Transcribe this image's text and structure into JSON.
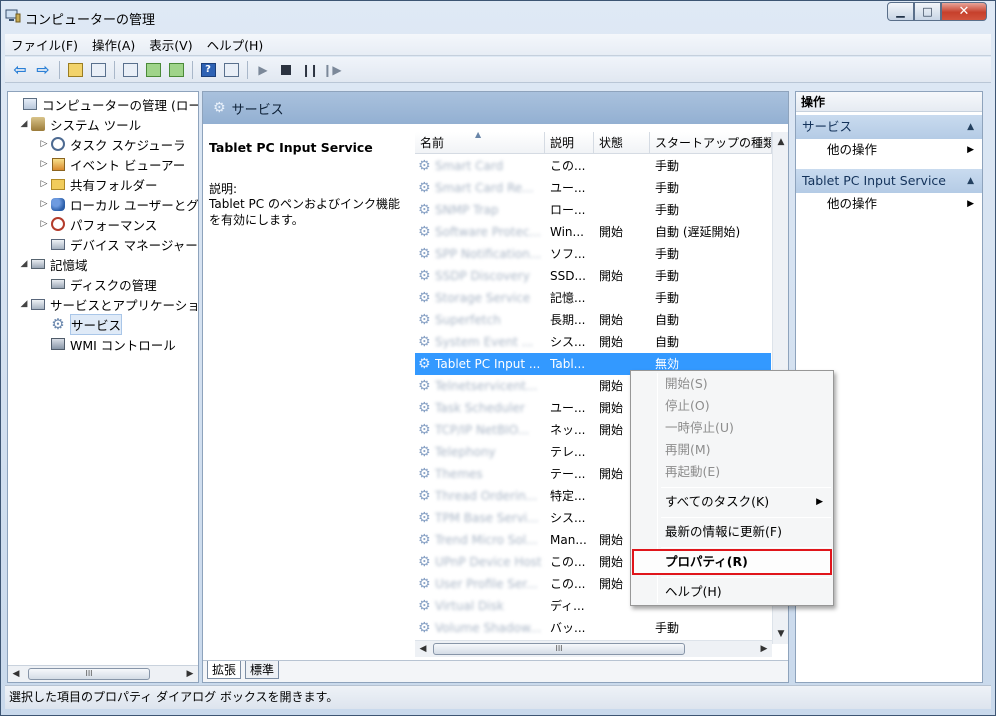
{
  "window": {
    "title": "コンピューターの管理",
    "controls": {
      "minimize": "▁",
      "maximize": "□",
      "close": "✕"
    }
  },
  "menu": [
    "ファイル(F)",
    "操作(A)",
    "表示(V)",
    "ヘルプ(H)"
  ],
  "tree": {
    "items": [
      {
        "label": "コンピューターの管理 (ローカル)",
        "twisty": "",
        "icon": "computer-icon"
      },
      {
        "label": "システム ツール",
        "twisty": "◢",
        "icon": "tools-icon"
      },
      {
        "label": "タスク スケジューラ",
        "twisty": "▷",
        "icon": "clock-icon"
      },
      {
        "label": "イベント ビューアー",
        "twisty": "▷",
        "icon": "event-viewer-icon"
      },
      {
        "label": "共有フォルダー",
        "twisty": "▷",
        "icon": "shared-folder-icon"
      },
      {
        "label": "ローカル ユーザーとグループ",
        "twisty": "▷",
        "icon": "users-icon"
      },
      {
        "label": "パフォーマンス",
        "twisty": "▷",
        "icon": "performance-icon"
      },
      {
        "label": "デバイス マネージャー",
        "twisty": "",
        "icon": "device-manager-icon"
      },
      {
        "label": "記憶域",
        "twisty": "◢",
        "icon": "storage-icon"
      },
      {
        "label": "ディスクの管理",
        "twisty": "",
        "icon": "disk-icon"
      },
      {
        "label": "サービスとアプリケーション",
        "twisty": "◢",
        "icon": "services-apps-icon"
      },
      {
        "label": "サービス",
        "twisty": "",
        "icon": "gear-icon"
      },
      {
        "label": "WMI コントロール",
        "twisty": "",
        "icon": "wmi-icon"
      }
    ],
    "scroll_thumb": "III"
  },
  "center": {
    "header": "サービス",
    "selected_name": "Tablet PC Input Service",
    "desc_label": "説明:",
    "desc_text": "Tablet PC のペンおよびインク機能を有効にします。",
    "columns": [
      "名前",
      "説明",
      "状態",
      "スタートアップの種類"
    ],
    "rows": [
      {
        "name": "Smart Card",
        "desc": "この...",
        "status": "",
        "startup": "手動"
      },
      {
        "name": "Smart Card Re...",
        "desc": "ユー...",
        "status": "",
        "startup": "手動"
      },
      {
        "name": "SNMP Trap",
        "desc": "ロー...",
        "status": "",
        "startup": "手動"
      },
      {
        "name": "Software Protec...",
        "desc": "Win...",
        "status": "開始",
        "startup": "自動 (遅延開始)"
      },
      {
        "name": "SPP Notification...",
        "desc": "ソフ...",
        "status": "",
        "startup": "手動"
      },
      {
        "name": "SSDP Discovery",
        "desc": "SSD...",
        "status": "開始",
        "startup": "手動"
      },
      {
        "name": "Storage Service",
        "desc": "記憶...",
        "status": "",
        "startup": "手動"
      },
      {
        "name": "Superfetch",
        "desc": "長期...",
        "status": "開始",
        "startup": "自動"
      },
      {
        "name": "System Event ...",
        "desc": "シス...",
        "status": "開始",
        "startup": "自動"
      },
      {
        "name": "Tablet PC Input ...",
        "desc": "Tabl...",
        "status": "",
        "startup": "無効"
      },
      {
        "name": "Telnetservicent...",
        "desc": "",
        "status": "開始",
        "startup": ""
      },
      {
        "name": "Task Scheduler",
        "desc": "ユー...",
        "status": "開始",
        "startup": ""
      },
      {
        "name": "TCP/IP NetBIO...",
        "desc": "ネッ...",
        "status": "開始",
        "startup": ""
      },
      {
        "name": "Telephony",
        "desc": "テレ...",
        "status": "",
        "startup": ""
      },
      {
        "name": "Themes",
        "desc": "テー...",
        "status": "開始",
        "startup": ""
      },
      {
        "name": "Thread Orderin...",
        "desc": "特定...",
        "status": "",
        "startup": ""
      },
      {
        "name": "TPM Base Servi...",
        "desc": "シス...",
        "status": "",
        "startup": ""
      },
      {
        "name": "Trend Micro Sol...",
        "desc": "Man...",
        "status": "開始",
        "startup": ""
      },
      {
        "name": "UPnP Device Host",
        "desc": "この...",
        "status": "開始",
        "startup": ""
      },
      {
        "name": "User Profile Ser...",
        "desc": "この...",
        "status": "開始",
        "startup": ""
      },
      {
        "name": "Virtual Disk",
        "desc": "ディ...",
        "status": "",
        "startup": ""
      },
      {
        "name": "Volume Shadow...",
        "desc": "バッ...",
        "status": "",
        "startup": "手動"
      }
    ],
    "selected_index": 9,
    "tabs": [
      "拡張",
      "標準"
    ],
    "hscroll_thumb": "III"
  },
  "actions": {
    "title": "操作",
    "sections": [
      {
        "label": "サービス",
        "item": "他の操作"
      },
      {
        "label": "Tablet PC Input Service",
        "item": "他の操作"
      }
    ]
  },
  "context_menu": {
    "items": [
      {
        "label": "開始(S)",
        "disabled": true
      },
      {
        "label": "停止(O)",
        "disabled": true
      },
      {
        "label": "一時停止(U)",
        "disabled": true
      },
      {
        "label": "再開(M)",
        "disabled": true
      },
      {
        "label": "再起動(E)",
        "disabled": true
      },
      {
        "label": "すべてのタスク(K)",
        "disabled": false,
        "submenu": true
      },
      {
        "label": "最新の情報に更新(F)",
        "disabled": false
      },
      {
        "label": "プロパティ(R)",
        "disabled": false,
        "highlighted": true
      },
      {
        "label": "ヘルプ(H)",
        "disabled": false
      }
    ]
  },
  "status_text": "選択した項目のプロパティ ダイアログ ボックスを開きます。",
  "colors": {
    "selection": "#3399ff",
    "highlight_border": "#e0151b",
    "header": "#93b0d2"
  }
}
